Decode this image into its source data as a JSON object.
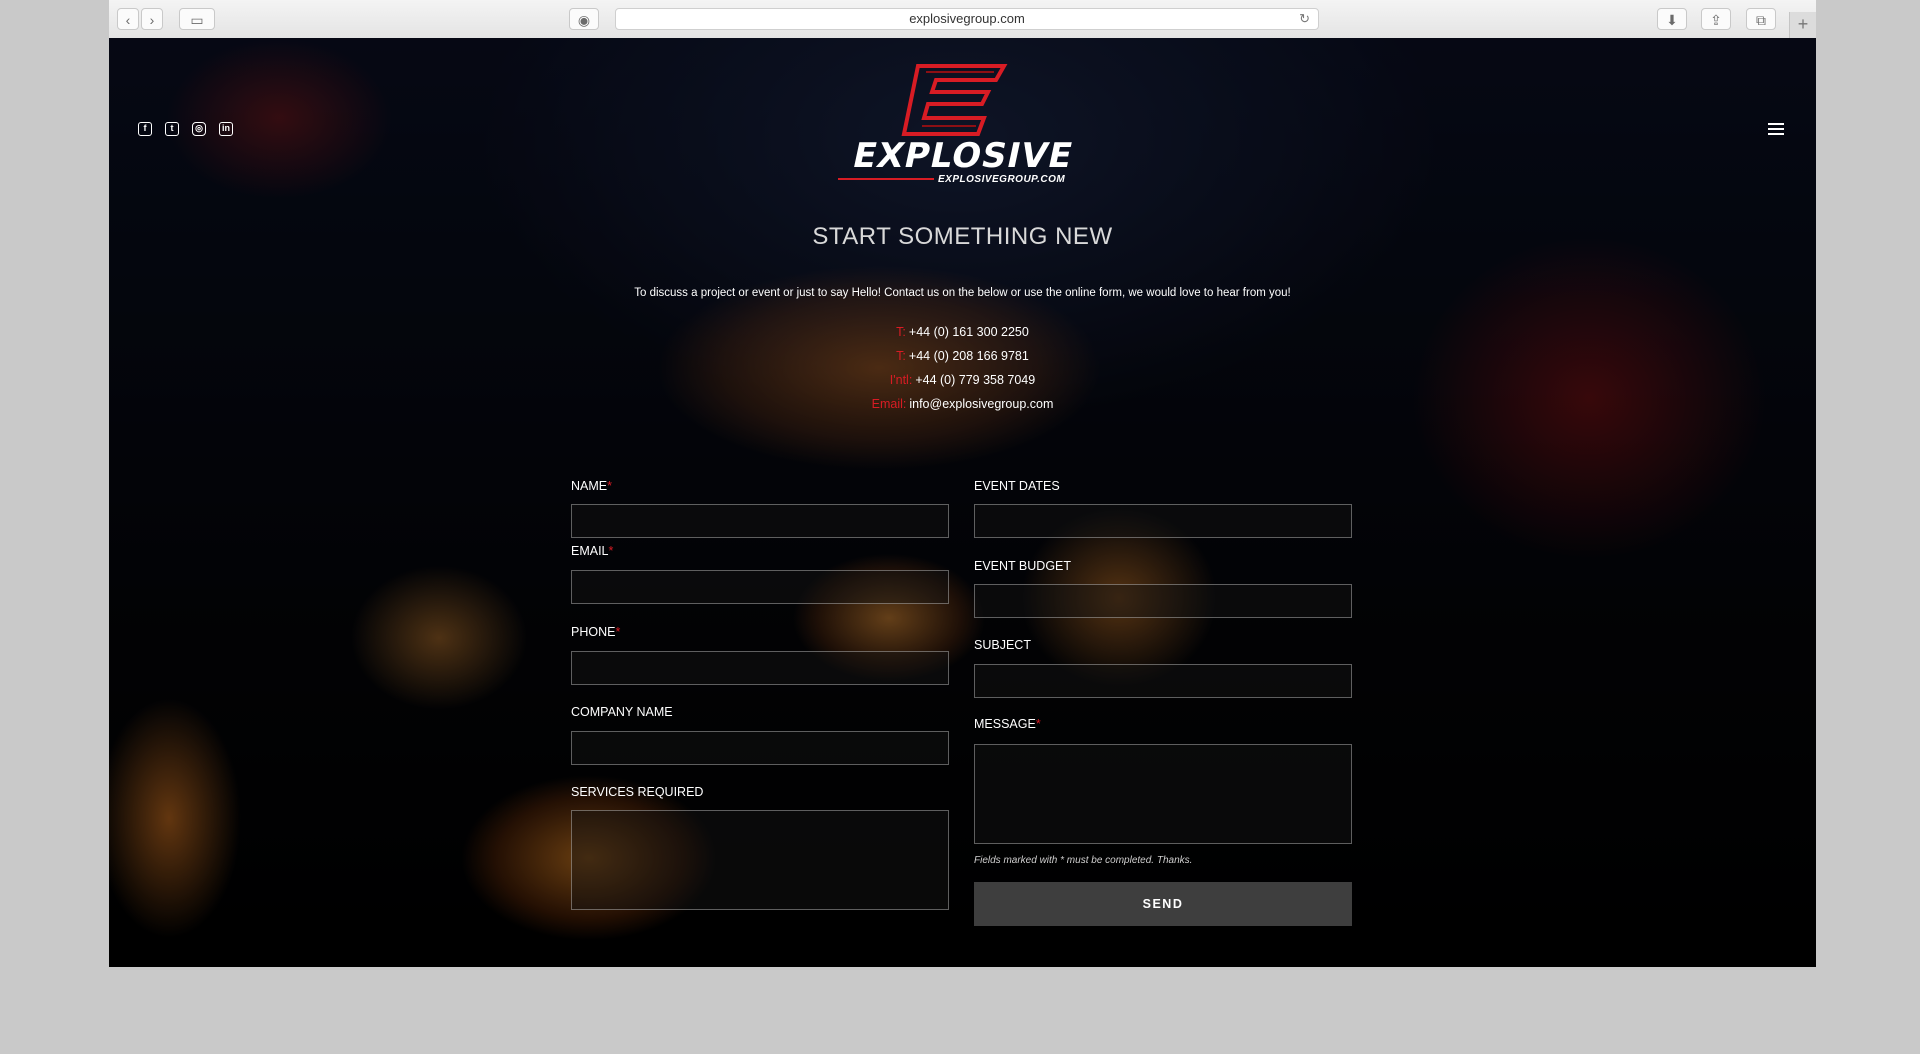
{
  "browser": {
    "url": "explosivegroup.com",
    "icons": {
      "back": "chevron-left-icon",
      "forward": "chevron-right-icon",
      "sidebar": "sidebar-icon",
      "privacy": "privacy-icon",
      "reload": "reload-icon",
      "download": "download-icon",
      "share": "share-icon",
      "tabs": "tabs-icon",
      "new_tab": "plus-icon"
    }
  },
  "brand": {
    "name": "EXPLOSIVE",
    "domain": "EXPLOSIVEGROUP.COM",
    "accent": "#d81c24"
  },
  "social": [
    "facebook-icon",
    "twitter-icon",
    "instagram-icon",
    "linkedin-icon"
  ],
  "page": {
    "headline": "START SOMETHING NEW",
    "intro": "To discuss a project or event or just to say Hello! Contact us on the below or use the online form, we would love to hear from you!",
    "contacts": [
      {
        "label": "T:",
        "value": "+44 (0) 161 300 2250"
      },
      {
        "label": "T:",
        "value": "+44 (0) 208 166 9781"
      },
      {
        "label": "I'ntl:",
        "value": "+44 (0) 779 358 7049"
      },
      {
        "label": "Email:",
        "value": "info@explosivegroup.com"
      }
    ]
  },
  "form": {
    "left": [
      {
        "label": "NAME",
        "required": "*"
      },
      {
        "label": "EMAIL",
        "required": "*"
      },
      {
        "label": "PHONE",
        "required": "*"
      },
      {
        "label": "COMPANY NAME",
        "required": ""
      },
      {
        "label": "SERVICES REQUIRED",
        "required": ""
      }
    ],
    "right": [
      {
        "label": "EVENT DATES",
        "required": ""
      },
      {
        "label": "EVENT BUDGET",
        "required": ""
      },
      {
        "label": "SUBJECT",
        "required": ""
      },
      {
        "label": "MESSAGE",
        "required": "*"
      }
    ],
    "note": "Fields marked with * must be completed. Thanks.",
    "send_label": "SEND"
  }
}
